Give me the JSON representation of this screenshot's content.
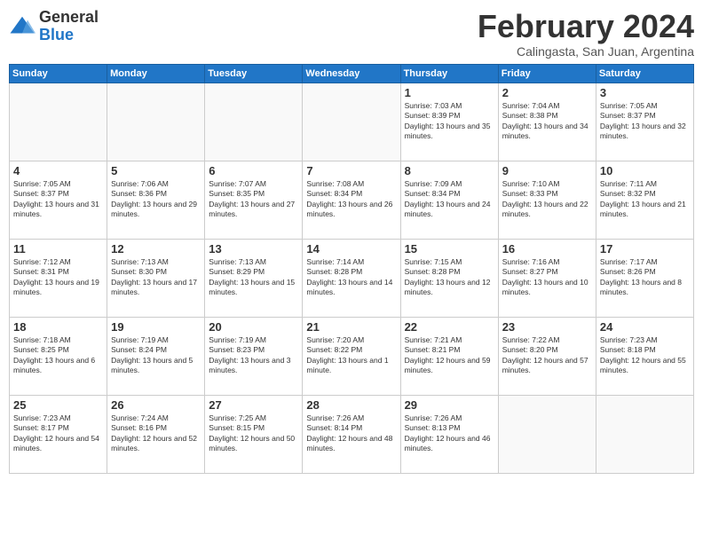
{
  "logo": {
    "general": "General",
    "blue": "Blue"
  },
  "header": {
    "title": "February 2024",
    "subtitle": "Calingasta, San Juan, Argentina"
  },
  "weekdays": [
    "Sunday",
    "Monday",
    "Tuesday",
    "Wednesday",
    "Thursday",
    "Friday",
    "Saturday"
  ],
  "weeks": [
    [
      {
        "day": "",
        "info": ""
      },
      {
        "day": "",
        "info": ""
      },
      {
        "day": "",
        "info": ""
      },
      {
        "day": "",
        "info": ""
      },
      {
        "day": "1",
        "info": "Sunrise: 7:03 AM\nSunset: 8:39 PM\nDaylight: 13 hours and 35 minutes."
      },
      {
        "day": "2",
        "info": "Sunrise: 7:04 AM\nSunset: 8:38 PM\nDaylight: 13 hours and 34 minutes."
      },
      {
        "day": "3",
        "info": "Sunrise: 7:05 AM\nSunset: 8:37 PM\nDaylight: 13 hours and 32 minutes."
      }
    ],
    [
      {
        "day": "4",
        "info": "Sunrise: 7:05 AM\nSunset: 8:37 PM\nDaylight: 13 hours and 31 minutes."
      },
      {
        "day": "5",
        "info": "Sunrise: 7:06 AM\nSunset: 8:36 PM\nDaylight: 13 hours and 29 minutes."
      },
      {
        "day": "6",
        "info": "Sunrise: 7:07 AM\nSunset: 8:35 PM\nDaylight: 13 hours and 27 minutes."
      },
      {
        "day": "7",
        "info": "Sunrise: 7:08 AM\nSunset: 8:34 PM\nDaylight: 13 hours and 26 minutes."
      },
      {
        "day": "8",
        "info": "Sunrise: 7:09 AM\nSunset: 8:34 PM\nDaylight: 13 hours and 24 minutes."
      },
      {
        "day": "9",
        "info": "Sunrise: 7:10 AM\nSunset: 8:33 PM\nDaylight: 13 hours and 22 minutes."
      },
      {
        "day": "10",
        "info": "Sunrise: 7:11 AM\nSunset: 8:32 PM\nDaylight: 13 hours and 21 minutes."
      }
    ],
    [
      {
        "day": "11",
        "info": "Sunrise: 7:12 AM\nSunset: 8:31 PM\nDaylight: 13 hours and 19 minutes."
      },
      {
        "day": "12",
        "info": "Sunrise: 7:13 AM\nSunset: 8:30 PM\nDaylight: 13 hours and 17 minutes."
      },
      {
        "day": "13",
        "info": "Sunrise: 7:13 AM\nSunset: 8:29 PM\nDaylight: 13 hours and 15 minutes."
      },
      {
        "day": "14",
        "info": "Sunrise: 7:14 AM\nSunset: 8:28 PM\nDaylight: 13 hours and 14 minutes."
      },
      {
        "day": "15",
        "info": "Sunrise: 7:15 AM\nSunset: 8:28 PM\nDaylight: 13 hours and 12 minutes."
      },
      {
        "day": "16",
        "info": "Sunrise: 7:16 AM\nSunset: 8:27 PM\nDaylight: 13 hours and 10 minutes."
      },
      {
        "day": "17",
        "info": "Sunrise: 7:17 AM\nSunset: 8:26 PM\nDaylight: 13 hours and 8 minutes."
      }
    ],
    [
      {
        "day": "18",
        "info": "Sunrise: 7:18 AM\nSunset: 8:25 PM\nDaylight: 13 hours and 6 minutes."
      },
      {
        "day": "19",
        "info": "Sunrise: 7:19 AM\nSunset: 8:24 PM\nDaylight: 13 hours and 5 minutes."
      },
      {
        "day": "20",
        "info": "Sunrise: 7:19 AM\nSunset: 8:23 PM\nDaylight: 13 hours and 3 minutes."
      },
      {
        "day": "21",
        "info": "Sunrise: 7:20 AM\nSunset: 8:22 PM\nDaylight: 13 hours and 1 minute."
      },
      {
        "day": "22",
        "info": "Sunrise: 7:21 AM\nSunset: 8:21 PM\nDaylight: 12 hours and 59 minutes."
      },
      {
        "day": "23",
        "info": "Sunrise: 7:22 AM\nSunset: 8:20 PM\nDaylight: 12 hours and 57 minutes."
      },
      {
        "day": "24",
        "info": "Sunrise: 7:23 AM\nSunset: 8:18 PM\nDaylight: 12 hours and 55 minutes."
      }
    ],
    [
      {
        "day": "25",
        "info": "Sunrise: 7:23 AM\nSunset: 8:17 PM\nDaylight: 12 hours and 54 minutes."
      },
      {
        "day": "26",
        "info": "Sunrise: 7:24 AM\nSunset: 8:16 PM\nDaylight: 12 hours and 52 minutes."
      },
      {
        "day": "27",
        "info": "Sunrise: 7:25 AM\nSunset: 8:15 PM\nDaylight: 12 hours and 50 minutes."
      },
      {
        "day": "28",
        "info": "Sunrise: 7:26 AM\nSunset: 8:14 PM\nDaylight: 12 hours and 48 minutes."
      },
      {
        "day": "29",
        "info": "Sunrise: 7:26 AM\nSunset: 8:13 PM\nDaylight: 12 hours and 46 minutes."
      },
      {
        "day": "",
        "info": ""
      },
      {
        "day": "",
        "info": ""
      }
    ]
  ]
}
